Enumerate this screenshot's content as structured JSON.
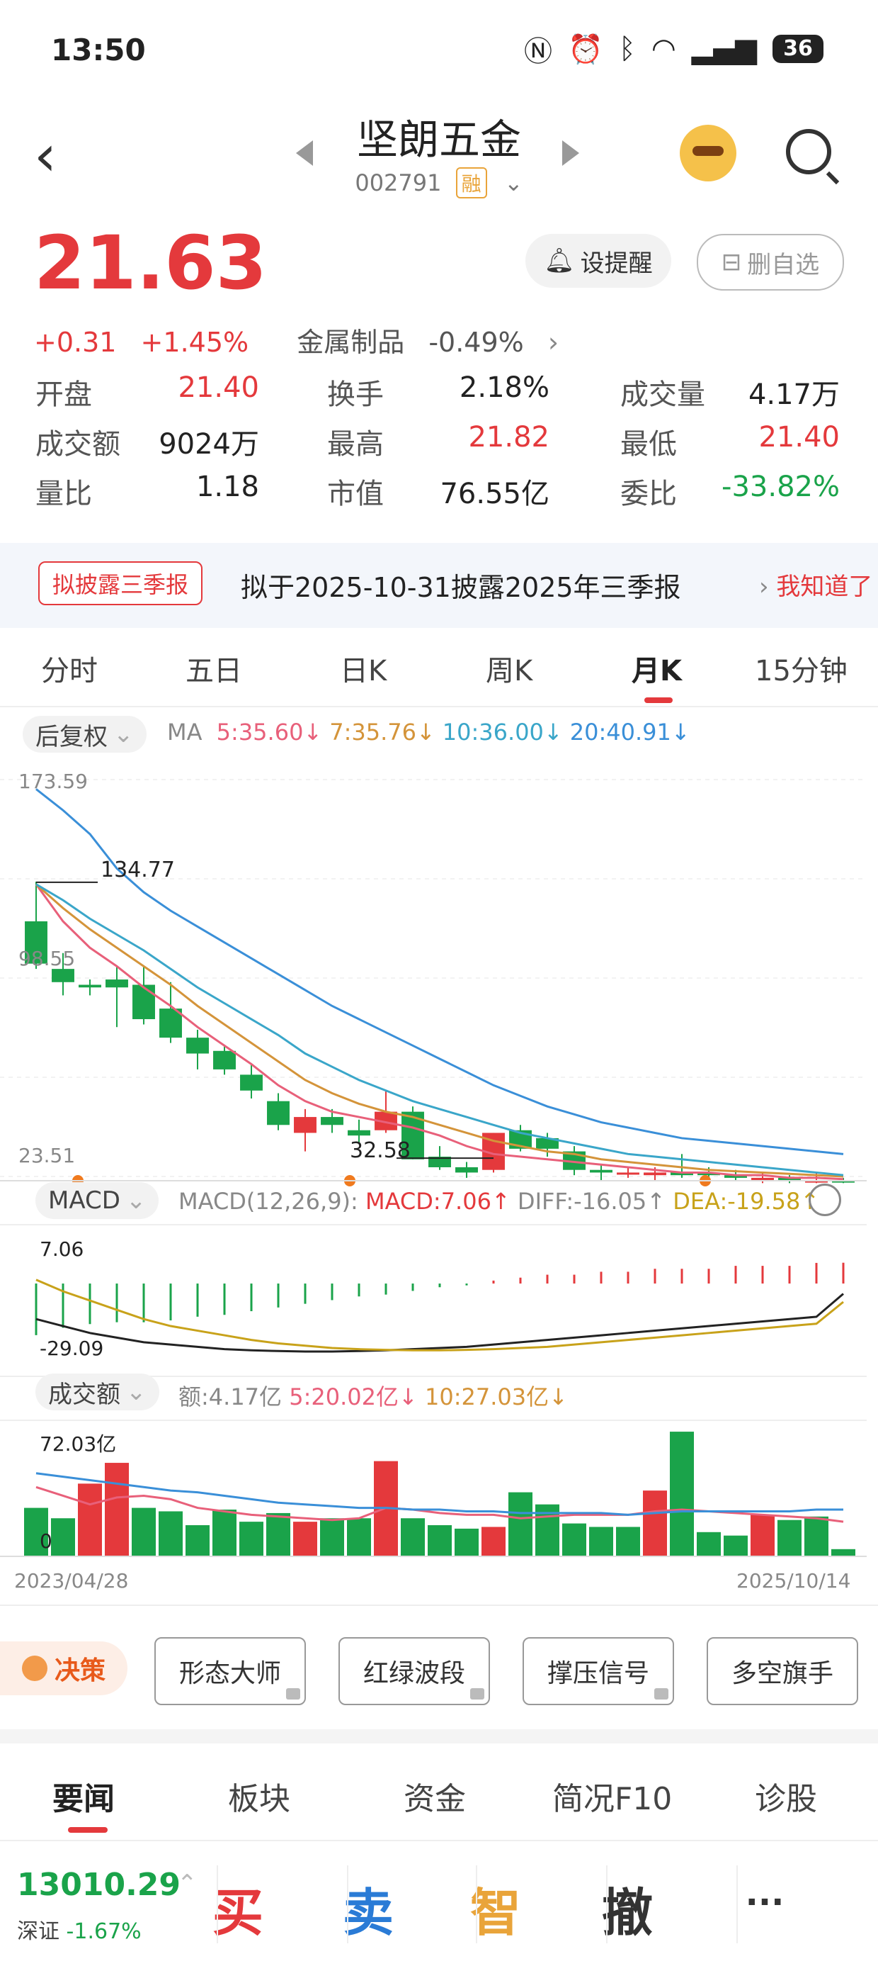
{
  "status_bar": {
    "time": "13:50",
    "battery": "36",
    "icons": [
      "nfc-icon",
      "alarm-icon",
      "bluetooth-icon",
      "wifi-icon",
      "5g-signal-icon",
      "battery-icon"
    ]
  },
  "header": {
    "name": "坚朗五金",
    "code": "002791",
    "badge": "融"
  },
  "quote": {
    "price": "21.63",
    "change": "+0.31",
    "change_pct": "+1.45%",
    "sector": "金属制品",
    "sector_pct": "-0.49%",
    "alert_button": "设提醒",
    "delete_button": "删自选"
  },
  "stats": [
    {
      "label": "开盘",
      "value": "21.40",
      "color": "#e4393c"
    },
    {
      "label": "换手",
      "value": "2.18%",
      "color": "#222222"
    },
    {
      "label": "成交量",
      "value": "4.17万",
      "color": "#222222"
    },
    {
      "label": "成交额",
      "value": "9024万",
      "color": "#222222"
    },
    {
      "label": "最高",
      "value": "21.82",
      "color": "#e4393c"
    },
    {
      "label": "最低",
      "value": "21.40",
      "color": "#e4393c"
    },
    {
      "label": "量比",
      "value": "1.18",
      "color": "#222222"
    },
    {
      "label": "市值",
      "value": "76.55亿",
      "color": "#222222"
    },
    {
      "label": "委比",
      "value": "-33.82%",
      "color": "#1aa34a"
    }
  ],
  "banner": {
    "tag": "拟披露三季报",
    "text": "拟于2025-10-31披露2025年三季报",
    "action": "我知道了"
  },
  "tabs": [
    "分时",
    "五日",
    "日K",
    "周K",
    "月K",
    "15分钟"
  ],
  "active_tab": "月K",
  "chart": {
    "adjust": "后复权",
    "ma_label": "MA",
    "ma": [
      {
        "text": "5:35.60↓",
        "color": "#e8607a"
      },
      {
        "text": "7:35.76↓",
        "color": "#d4943a"
      },
      {
        "text": "10:36.00↓",
        "color": "#3aa6c9"
      },
      {
        "text": "20:40.91↓",
        "color": "#3a8fd8"
      }
    ],
    "y_top": "173.59",
    "y_mid": "98.55",
    "y_bottom": "23.51",
    "high_label": "134.77",
    "low_label": "32.58",
    "macd_label": "MACD",
    "macd_params": "MACD(12,26,9):",
    "macd_value": "MACD:7.06↑",
    "diff_value": "DIFF:-16.05↑",
    "dea_value": "DEA:-19.58↑",
    "macd_top": "7.06",
    "macd_bottom": "-29.09",
    "vol_label": "成交额",
    "vol_amount": "额:4.17亿",
    "vol_ma5": "5:20.02亿↓",
    "vol_ma10": "10:27.03亿↓",
    "vol_top": "72.03亿",
    "vol_zero": "0",
    "date_start": "2023/04/28",
    "date_end": "2025/10/14"
  },
  "chart_data": {
    "type": "candlestick",
    "period": "monthly",
    "candles": [
      {
        "open": 120,
        "close": 104,
        "high": 135,
        "low": 102
      },
      {
        "open": 102,
        "close": 97,
        "high": 108,
        "low": 92
      },
      {
        "open": 96,
        "close": 95,
        "high": 98,
        "low": 92
      },
      {
        "open": 98,
        "close": 95,
        "high": 103,
        "low": 80
      },
      {
        "open": 96,
        "close": 83,
        "high": 103,
        "low": 81
      },
      {
        "open": 87,
        "close": 76,
        "high": 97,
        "low": 74
      },
      {
        "open": 76,
        "close": 70,
        "high": 79,
        "low": 64
      },
      {
        "open": 71,
        "close": 64,
        "high": 73,
        "low": 62
      },
      {
        "open": 62,
        "close": 56,
        "high": 66,
        "low": 53
      },
      {
        "open": 52,
        "close": 43,
        "high": 55,
        "low": 41
      },
      {
        "open": 40,
        "close": 46,
        "high": 49,
        "low": 33
      },
      {
        "open": 46,
        "close": 43,
        "high": 49,
        "low": 40
      },
      {
        "open": 41,
        "close": 39,
        "high": 45,
        "low": 36
      },
      {
        "open": 41,
        "close": 48,
        "high": 56,
        "low": 40
      },
      {
        "open": 48,
        "close": 30,
        "high": 50,
        "low": 30
      },
      {
        "open": 31,
        "close": 27,
        "high": 35,
        "low": 26
      },
      {
        "open": 27,
        "close": 25,
        "high": 29,
        "low": 23
      },
      {
        "open": 26,
        "close": 40,
        "high": 40,
        "low": 25
      },
      {
        "open": 41,
        "close": 34,
        "high": 43,
        "low": 33
      },
      {
        "open": 38,
        "close": 34,
        "high": 40,
        "low": 31
      },
      {
        "open": 33,
        "close": 26,
        "high": 35,
        "low": 24
      },
      {
        "open": 26,
        "close": 25,
        "high": 28,
        "low": 22
      },
      {
        "open": 25,
        "close": 25,
        "high": 27,
        "low": 23
      },
      {
        "open": 24,
        "close": 25,
        "high": 27,
        "low": 22
      },
      {
        "open": 25,
        "close": 24,
        "high": 32,
        "low": 23
      },
      {
        "open": 25,
        "close": 24,
        "high": 27,
        "low": 23
      },
      {
        "open": 24,
        "close": 23,
        "high": 26,
        "low": 22
      },
      {
        "open": 22,
        "close": 23,
        "high": 25,
        "low": 21
      },
      {
        "open": 23,
        "close": 22,
        "high": 24,
        "low": 21
      },
      {
        "open": 22,
        "close": 22,
        "high": 25,
        "low": 21
      },
      {
        "open": 22,
        "close": 21.63,
        "high": 23,
        "low": 21
      }
    ],
    "ma_lines": [
      {
        "name": "MA5",
        "color": "#e8607a",
        "values": [
          134,
          120,
          110,
          103,
          95,
          88,
          80,
          73,
          66,
          58,
          52,
          48,
          46,
          44,
          42,
          39,
          35,
          32,
          31,
          30,
          29,
          28,
          27,
          26,
          25,
          25,
          24,
          24,
          23,
          23,
          22.5
        ]
      },
      {
        "name": "MA7",
        "color": "#d4943a",
        "values": [
          134,
          125,
          117,
          110,
          103,
          96,
          88,
          81,
          74,
          67,
          60,
          55,
          51,
          48,
          46,
          43,
          40,
          37,
          35,
          33,
          32,
          30,
          29,
          28,
          27,
          26,
          25.5,
          25,
          24.5,
          24,
          23.5
        ]
      },
      {
        "name": "MA10",
        "color": "#3aa6c9",
        "values": [
          134,
          128,
          121,
          115,
          109,
          102,
          95,
          89,
          83,
          77,
          70,
          65,
          60,
          56,
          52,
          49,
          46,
          43,
          40,
          38,
          36,
          34,
          32,
          31,
          30,
          29,
          28,
          27,
          26,
          25,
          24
        ]
      },
      {
        "name": "MA20",
        "color": "#3a8fd8",
        "values": [
          170,
          162,
          153,
          140,
          131,
          124,
          118,
          112,
          106,
          100,
          94,
          88,
          83,
          78,
          73,
          68,
          63,
          58,
          54,
          50,
          47,
          44,
          42,
          40,
          38,
          37,
          36,
          35,
          34,
          33,
          32
        ]
      }
    ],
    "y_range": [
      23.51,
      173.59
    ],
    "macd": {
      "hist": [
        -28,
        -24,
        -22,
        -21,
        -21,
        -20,
        -18,
        -17,
        -15,
        -13,
        -11,
        -9,
        -7,
        -6,
        -4,
        -2,
        -1,
        1,
        2,
        3,
        3,
        4,
        4,
        5,
        5,
        5,
        6,
        6,
        6,
        7,
        7.06
      ],
      "diff": [
        -27,
        -30,
        -33,
        -35,
        -37,
        -38,
        -39,
        -40,
        -40.5,
        -40.8,
        -41,
        -41,
        -40.8,
        -40.5,
        -40,
        -39.5,
        -39,
        -38,
        -37,
        -36,
        -35,
        -34,
        -33,
        -32,
        -31,
        -30,
        -29,
        -28,
        -27,
        -26,
        -16.05
      ],
      "dea": [
        -10,
        -15,
        -19,
        -23,
        -27,
        -30,
        -32,
        -34,
        -36,
        -37.5,
        -38.5,
        -39.5,
        -40,
        -40.3,
        -40.5,
        -40.5,
        -40.3,
        -40,
        -39.5,
        -39,
        -38,
        -37,
        -36,
        -35,
        -34,
        -33,
        -32,
        -31,
        -30,
        -29,
        -19.58
      ],
      "range": [
        -45,
        7.06
      ]
    },
    "volume": {
      "values": [
        28,
        22,
        42,
        54,
        28,
        26,
        18,
        27,
        20,
        25,
        20,
        22,
        22,
        55,
        22,
        18,
        16,
        17,
        37,
        30,
        19,
        17,
        17,
        38,
        72,
        14,
        12,
        24,
        21,
        23,
        4.17
      ],
      "colors": [
        "g",
        "g",
        "r",
        "r",
        "g",
        "g",
        "g",
        "g",
        "g",
        "g",
        "r",
        "g",
        "g",
        "r",
        "g",
        "g",
        "g",
        "r",
        "g",
        "g",
        "g",
        "g",
        "g",
        "r",
        "g",
        "g",
        "g",
        "r",
        "g",
        "g",
        "g"
      ],
      "ma5": [
        40,
        35,
        30,
        34,
        35,
        33,
        28,
        26,
        24,
        23,
        22,
        21,
        22,
        28,
        27,
        25,
        24,
        24,
        22,
        23,
        24,
        24,
        24,
        26,
        27,
        26,
        25,
        24,
        23,
        22,
        20.02
      ],
      "ma10": [
        48,
        46,
        44,
        42,
        40,
        38,
        37,
        35,
        33,
        31,
        30,
        29,
        28,
        28,
        27,
        27,
        26,
        26,
        25,
        25,
        25,
        25,
        24,
        25,
        26,
        26,
        26,
        26,
        26,
        27,
        27.03
      ],
      "range": [
        0,
        72.03
      ]
    },
    "x_range": [
      "2023/04/28",
      "2025/10/14"
    ]
  },
  "features": {
    "decision": "决策",
    "buttons": [
      "形态大师",
      "红绿波段",
      "撑压信号",
      "多空旗手"
    ]
  },
  "news_tabs": [
    "要闻",
    "板块",
    "资金",
    "简况F10",
    "诊股"
  ],
  "bottom": {
    "index_value": "13010.29",
    "index_name": "深证",
    "index_pct": "-1.67%",
    "actions": [
      {
        "label": "买",
        "color": "#e4393c"
      },
      {
        "label": "卖",
        "color": "#2a7bd6"
      },
      {
        "label": "智",
        "color": "#e9a43a"
      },
      {
        "label": "撤",
        "color": "#333333"
      },
      {
        "label": "···",
        "color": "#333333"
      }
    ]
  }
}
